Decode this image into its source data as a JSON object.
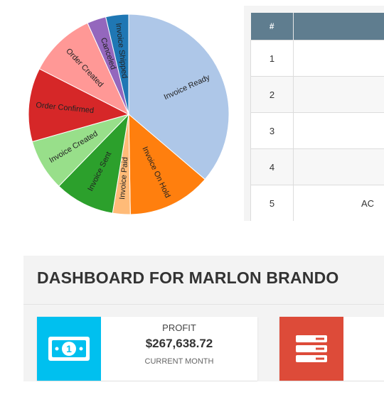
{
  "chart_data": {
    "type": "pie",
    "slices": [
      {
        "label": "Invoice Ready",
        "value": 34.4,
        "color": "#aec7e8"
      },
      {
        "label": "Invoice On Hold",
        "value": 12.8,
        "color": "#ff7f0e"
      },
      {
        "label": "Invoice Paid",
        "value": 2.7,
        "color": "#ffbb78"
      },
      {
        "label": "Invoice Sent",
        "value": 9.2,
        "color": "#2ca02c"
      },
      {
        "label": "Invoice Created",
        "value": 7.9,
        "color": "#98df8a"
      },
      {
        "label": "Order Confirmed",
        "value": 11.3,
        "color": "#d62728"
      },
      {
        "label": "Order Created",
        "value": 10.2,
        "color": "#ff9896"
      },
      {
        "label": "Canceled",
        "value": 2.9,
        "color": "#9467bd"
      },
      {
        "label": "Invoice Shipped",
        "value": 3.5,
        "color": "#1f77b4"
      }
    ]
  },
  "table": {
    "header_num": "#",
    "header_col2": "",
    "rows": [
      {
        "num": "1",
        "value": ""
      },
      {
        "num": "2",
        "value": ""
      },
      {
        "num": "3",
        "value": ""
      },
      {
        "num": "4",
        "value": ""
      },
      {
        "num": "5",
        "value": "AC"
      }
    ]
  },
  "dashboard": {
    "title": "DASHBOARD FOR MARLON BRANDO",
    "cards": [
      {
        "label": "PROFIT",
        "value": "$267,638.72",
        "sub": "CURRENT MONTH",
        "icon": "money-icon",
        "color": "#00c0ef"
      },
      {
        "label": "",
        "value": "",
        "sub": "",
        "icon": "server-icon",
        "color": "#dd4b39"
      }
    ]
  }
}
